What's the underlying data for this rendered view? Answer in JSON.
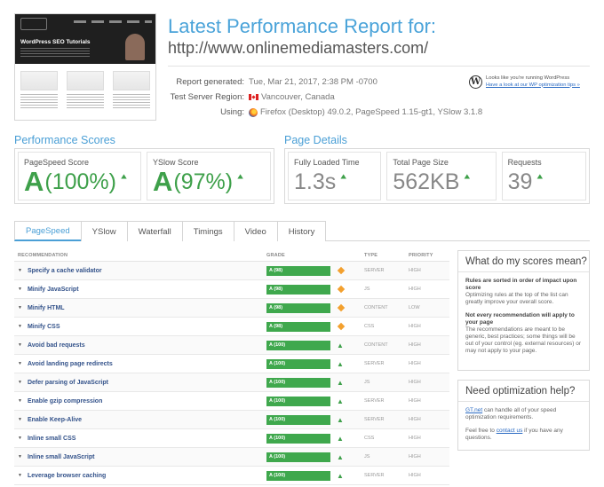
{
  "header": {
    "title": "Latest Performance Report for:",
    "url": "http://www.onlinemediamasters.com/",
    "thumbnail_headline": "WordPress SEO Tutorials"
  },
  "meta": {
    "report_generated_label": "Report generated:",
    "report_generated_value": "Tue, Mar 21, 2017, 2:38 PM -0700",
    "server_region_label": "Test Server Region:",
    "server_region_value": "Vancouver, Canada",
    "using_label": "Using:",
    "using_value": "Firefox (Desktop) 49.0.2, PageSpeed 1.15-gt1, YSlow 3.1.8"
  },
  "wordpress_notice": {
    "line1": "Looks like you're running WordPress",
    "link": "Have a look at our WP optimization tips »"
  },
  "performance_scores": {
    "title": "Performance Scores",
    "pagespeed": {
      "label": "PageSpeed Score",
      "grade": "A",
      "value": "(100%)"
    },
    "yslow": {
      "label": "YSlow Score",
      "grade": "A",
      "value": "(97%)"
    }
  },
  "page_details": {
    "title": "Page Details",
    "load_time": {
      "label": "Fully Loaded Time",
      "value": "1.3s"
    },
    "page_size": {
      "label": "Total Page Size",
      "value": "562KB"
    },
    "requests": {
      "label": "Requests",
      "value": "39"
    }
  },
  "tabs": [
    {
      "label": "PageSpeed",
      "active": true
    },
    {
      "label": "YSlow",
      "active": false
    },
    {
      "label": "Waterfall",
      "active": false
    },
    {
      "label": "Timings",
      "active": false
    },
    {
      "label": "Video",
      "active": false
    },
    {
      "label": "History",
      "active": false
    }
  ],
  "recommendations": {
    "columns": {
      "name": "RECOMMENDATION",
      "grade": "GRADE",
      "type": "TYPE",
      "priority": "PRIORITY"
    },
    "rows": [
      {
        "name": "Specify a cache validator",
        "grade": "A (98)",
        "grade_pct": 98,
        "icon": "diamond",
        "type": "SERVER",
        "priority": "HIGH"
      },
      {
        "name": "Minify JavaScript",
        "grade": "A (98)",
        "grade_pct": 98,
        "icon": "diamond",
        "type": "JS",
        "priority": "HIGH"
      },
      {
        "name": "Minify HTML",
        "grade": "A (98)",
        "grade_pct": 98,
        "icon": "diamond",
        "type": "CONTENT",
        "priority": "LOW"
      },
      {
        "name": "Minify CSS",
        "grade": "A (98)",
        "grade_pct": 98,
        "icon": "diamond",
        "type": "CSS",
        "priority": "HIGH"
      },
      {
        "name": "Avoid bad requests",
        "grade": "A (100)",
        "grade_pct": 100,
        "icon": "up",
        "type": "CONTENT",
        "priority": "HIGH"
      },
      {
        "name": "Avoid landing page redirects",
        "grade": "A (100)",
        "grade_pct": 100,
        "icon": "up",
        "type": "SERVER",
        "priority": "HIGH"
      },
      {
        "name": "Defer parsing of JavaScript",
        "grade": "A (100)",
        "grade_pct": 100,
        "icon": "up",
        "type": "JS",
        "priority": "HIGH"
      },
      {
        "name": "Enable gzip compression",
        "grade": "A (100)",
        "grade_pct": 100,
        "icon": "up",
        "type": "SERVER",
        "priority": "HIGH"
      },
      {
        "name": "Enable Keep-Alive",
        "grade": "A (100)",
        "grade_pct": 100,
        "icon": "up",
        "type": "SERVER",
        "priority": "HIGH"
      },
      {
        "name": "Inline small CSS",
        "grade": "A (100)",
        "grade_pct": 100,
        "icon": "up",
        "type": "CSS",
        "priority": "HIGH"
      },
      {
        "name": "Inline small JavaScript",
        "grade": "A (100)",
        "grade_pct": 100,
        "icon": "up",
        "type": "JS",
        "priority": "HIGH"
      },
      {
        "name": "Leverage browser caching",
        "grade": "A (100)",
        "grade_pct": 100,
        "icon": "up",
        "type": "SERVER",
        "priority": "HIGH"
      }
    ]
  },
  "scores_help": {
    "title": "What do my scores mean?",
    "p1_bold": "Rules are sorted in order of impact upon score",
    "p1_text": "Optimizing rules at the top of the list can greatly improve your overall score.",
    "p2_bold": "Not every recommendation will apply to your page",
    "p2_text": "The recommendations are meant to be generic, best practices; some things will be out of your control (eg. external resources) or may not apply to your page."
  },
  "optimization_help": {
    "title": "Need optimization help?",
    "p1_link": "GT.net",
    "p1_text": " can handle all of your speed optimization requirements.",
    "p2_pre": "Feel free to ",
    "p2_link": "contact us",
    "p2_post": " if you have any questions."
  },
  "colors": {
    "accent_blue": "#4a9fd6",
    "grade_green": "#3fa84d",
    "warn_orange": "#f3a02e",
    "link_blue": "#2a6ac2"
  }
}
